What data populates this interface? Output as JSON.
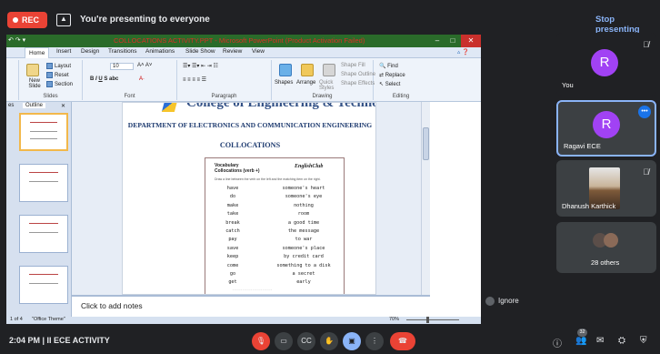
{
  "topbar": {
    "rec_label": "REC",
    "presenting_text": "You're presenting to everyone",
    "stop_label": "Stop presenting"
  },
  "window": {
    "title": "COLLOCATIONS ACTIVITY.PPT - Microsoft PowerPoint (Product Activation Failed)",
    "tabs": [
      "Home",
      "Insert",
      "Design",
      "Transitions",
      "Animations",
      "Slide Show",
      "Review",
      "View"
    ],
    "ribbon": {
      "slides_group": "Slides",
      "layout_label": "Layout",
      "reset_label": "Reset",
      "new_slide_label": "New Slide",
      "section_label": "Section",
      "font_group": "Font",
      "paragraph_group": "Paragraph",
      "drawing_group": "Drawing",
      "editing_group": "Editing",
      "shapes_label": "Shapes",
      "arrange_label": "Arrange",
      "quick_styles_label": "Quick Styles",
      "shape_fill_label": "Shape Fill",
      "shape_outline_label": "Shape Outline",
      "shape_effects_label": "Shape Effects",
      "find_label": "Find",
      "replace_label": "Replace",
      "select_label": "Select",
      "font_size": "10"
    },
    "pane_tabs": [
      "es",
      "Outline"
    ],
    "slide": {
      "college_text": "College of Engineering & Technology",
      "dept": "DEPARTMENT OF ELECTRONICS AND COMMUNICATION ENGINEERING",
      "title": "COLLOCATIONS",
      "worksheet": {
        "heading_1": "Vocabulary",
        "heading_2": "Collocations (verb +)",
        "brand": "EnglishClub",
        "instruction": "Draw a line between the verb on the left and the matching item on the right.",
        "left": [
          "have",
          "do",
          "make",
          "take",
          "break",
          "catch",
          "pay",
          "save",
          "keep",
          "come",
          "go",
          "get"
        ],
        "right": [
          "someone's heart",
          "someone's eye",
          "nothing",
          "room",
          "a good time",
          "the message",
          "to war",
          "someone's place",
          "by credit card",
          "something to a disk",
          "a secret",
          "early"
        ]
      }
    },
    "notes_placeholder": "Click to add notes",
    "status": {
      "slide_of": "1 of 4",
      "theme": "\"Office Theme\"",
      "zoom": "70%"
    }
  },
  "participants": [
    {
      "name": "You",
      "initial": "R"
    },
    {
      "name": "Ragavi ECE",
      "initial": "R"
    },
    {
      "name": "Dhanush Karthick"
    },
    {
      "name": "28 others"
    }
  ],
  "ignore_label": "Ignore",
  "bottombar": {
    "time": "2:04 PM",
    "meeting_name": "II ECE ACTIVITY",
    "participant_count": "32"
  },
  "colors": {
    "record_red": "#ea4335",
    "accent_blue": "#8ab4f8",
    "avatar_purple": "#a142f4",
    "ppt_titlebar": "#2a6b2a"
  }
}
